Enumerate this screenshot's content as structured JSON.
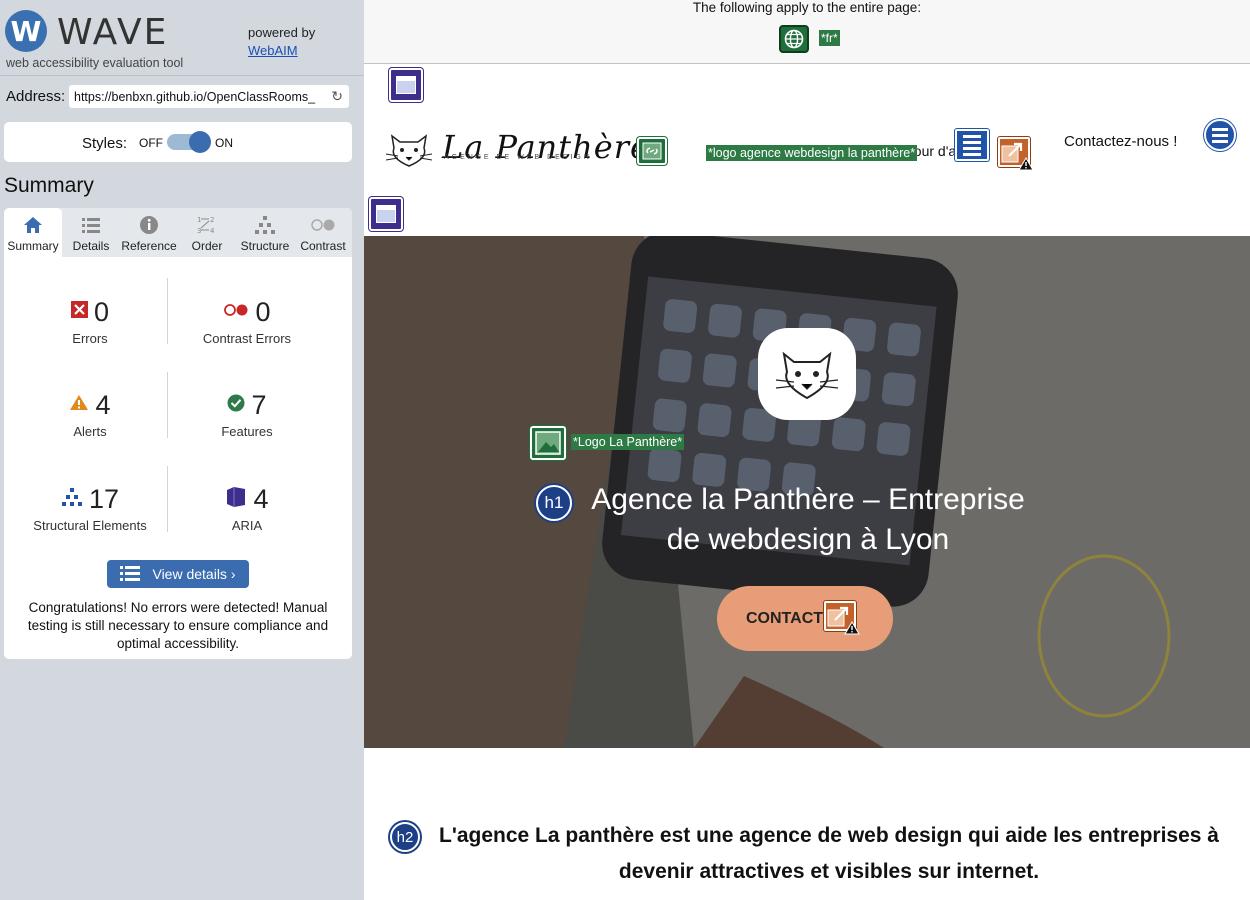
{
  "wave": {
    "logo_letter": "W",
    "title": "WAVE",
    "subtitle": "web accessibility evaluation tool",
    "powered_by": "powered by",
    "webaim_link": "WebAIM",
    "address_label": "Address:",
    "address_value": "https://benbxn.github.io/OpenClassRooms_",
    "styles_label": "Styles:",
    "styles_off": "OFF",
    "styles_on": "ON",
    "styles_enabled": true,
    "summary_heading": "Summary",
    "tabs": [
      {
        "label": "Summary",
        "icon": "home-icon",
        "active": true
      },
      {
        "label": "Details",
        "icon": "list-icon",
        "active": false
      },
      {
        "label": "Reference",
        "icon": "info-icon",
        "active": false
      },
      {
        "label": "Order",
        "icon": "order-icon",
        "active": false
      },
      {
        "label": "Structure",
        "icon": "structure-icon",
        "active": false
      },
      {
        "label": "Contrast",
        "icon": "contrast-icon",
        "active": false
      }
    ],
    "stats": {
      "errors": {
        "value": "0",
        "label": "Errors"
      },
      "contrast_errors": {
        "value": "0",
        "label": "Contrast Errors"
      },
      "alerts": {
        "value": "4",
        "label": "Alerts"
      },
      "features": {
        "value": "7",
        "label": "Features"
      },
      "structural": {
        "value": "17",
        "label": "Structural Elements"
      },
      "aria": {
        "value": "4",
        "label": "ARIA"
      }
    },
    "view_details": "View details ›",
    "congrats": "Congratulations! No errors were detected! Manual testing is still necessary to ensure compliance and optimal accessibility."
  },
  "page": {
    "apply_text": "The following apply to the entire page:",
    "lang_tag": "*fr*",
    "brand_name": "La Panthère",
    "brand_tagline": "AGENCE DE WEB DESIGN",
    "logo_alt": "*logo agence webdesign la panthère*",
    "nav_partial": "Retour d'ac",
    "nav_contact": "Contactez-nous !",
    "hero_logo_alt": "*Logo La Panthère*",
    "h1_badge": "h1",
    "hero_title": "Agence la Panthère – Entreprise de webdesign à Lyon",
    "hero_button": "CONTACT",
    "h2_badge": "h2",
    "h2_text": "L'agence La panthère est une agence de web design qui aide les entreprises à devenir attractives et visibles sur internet."
  },
  "colors": {
    "wave_blue": "#3b6cb0",
    "error_red": "#c62828",
    "alert_orange": "#e08a1e",
    "feature_green": "#2f7a4a",
    "aria_purple": "#3d2e8c",
    "structure_blue": "#2154a8"
  }
}
